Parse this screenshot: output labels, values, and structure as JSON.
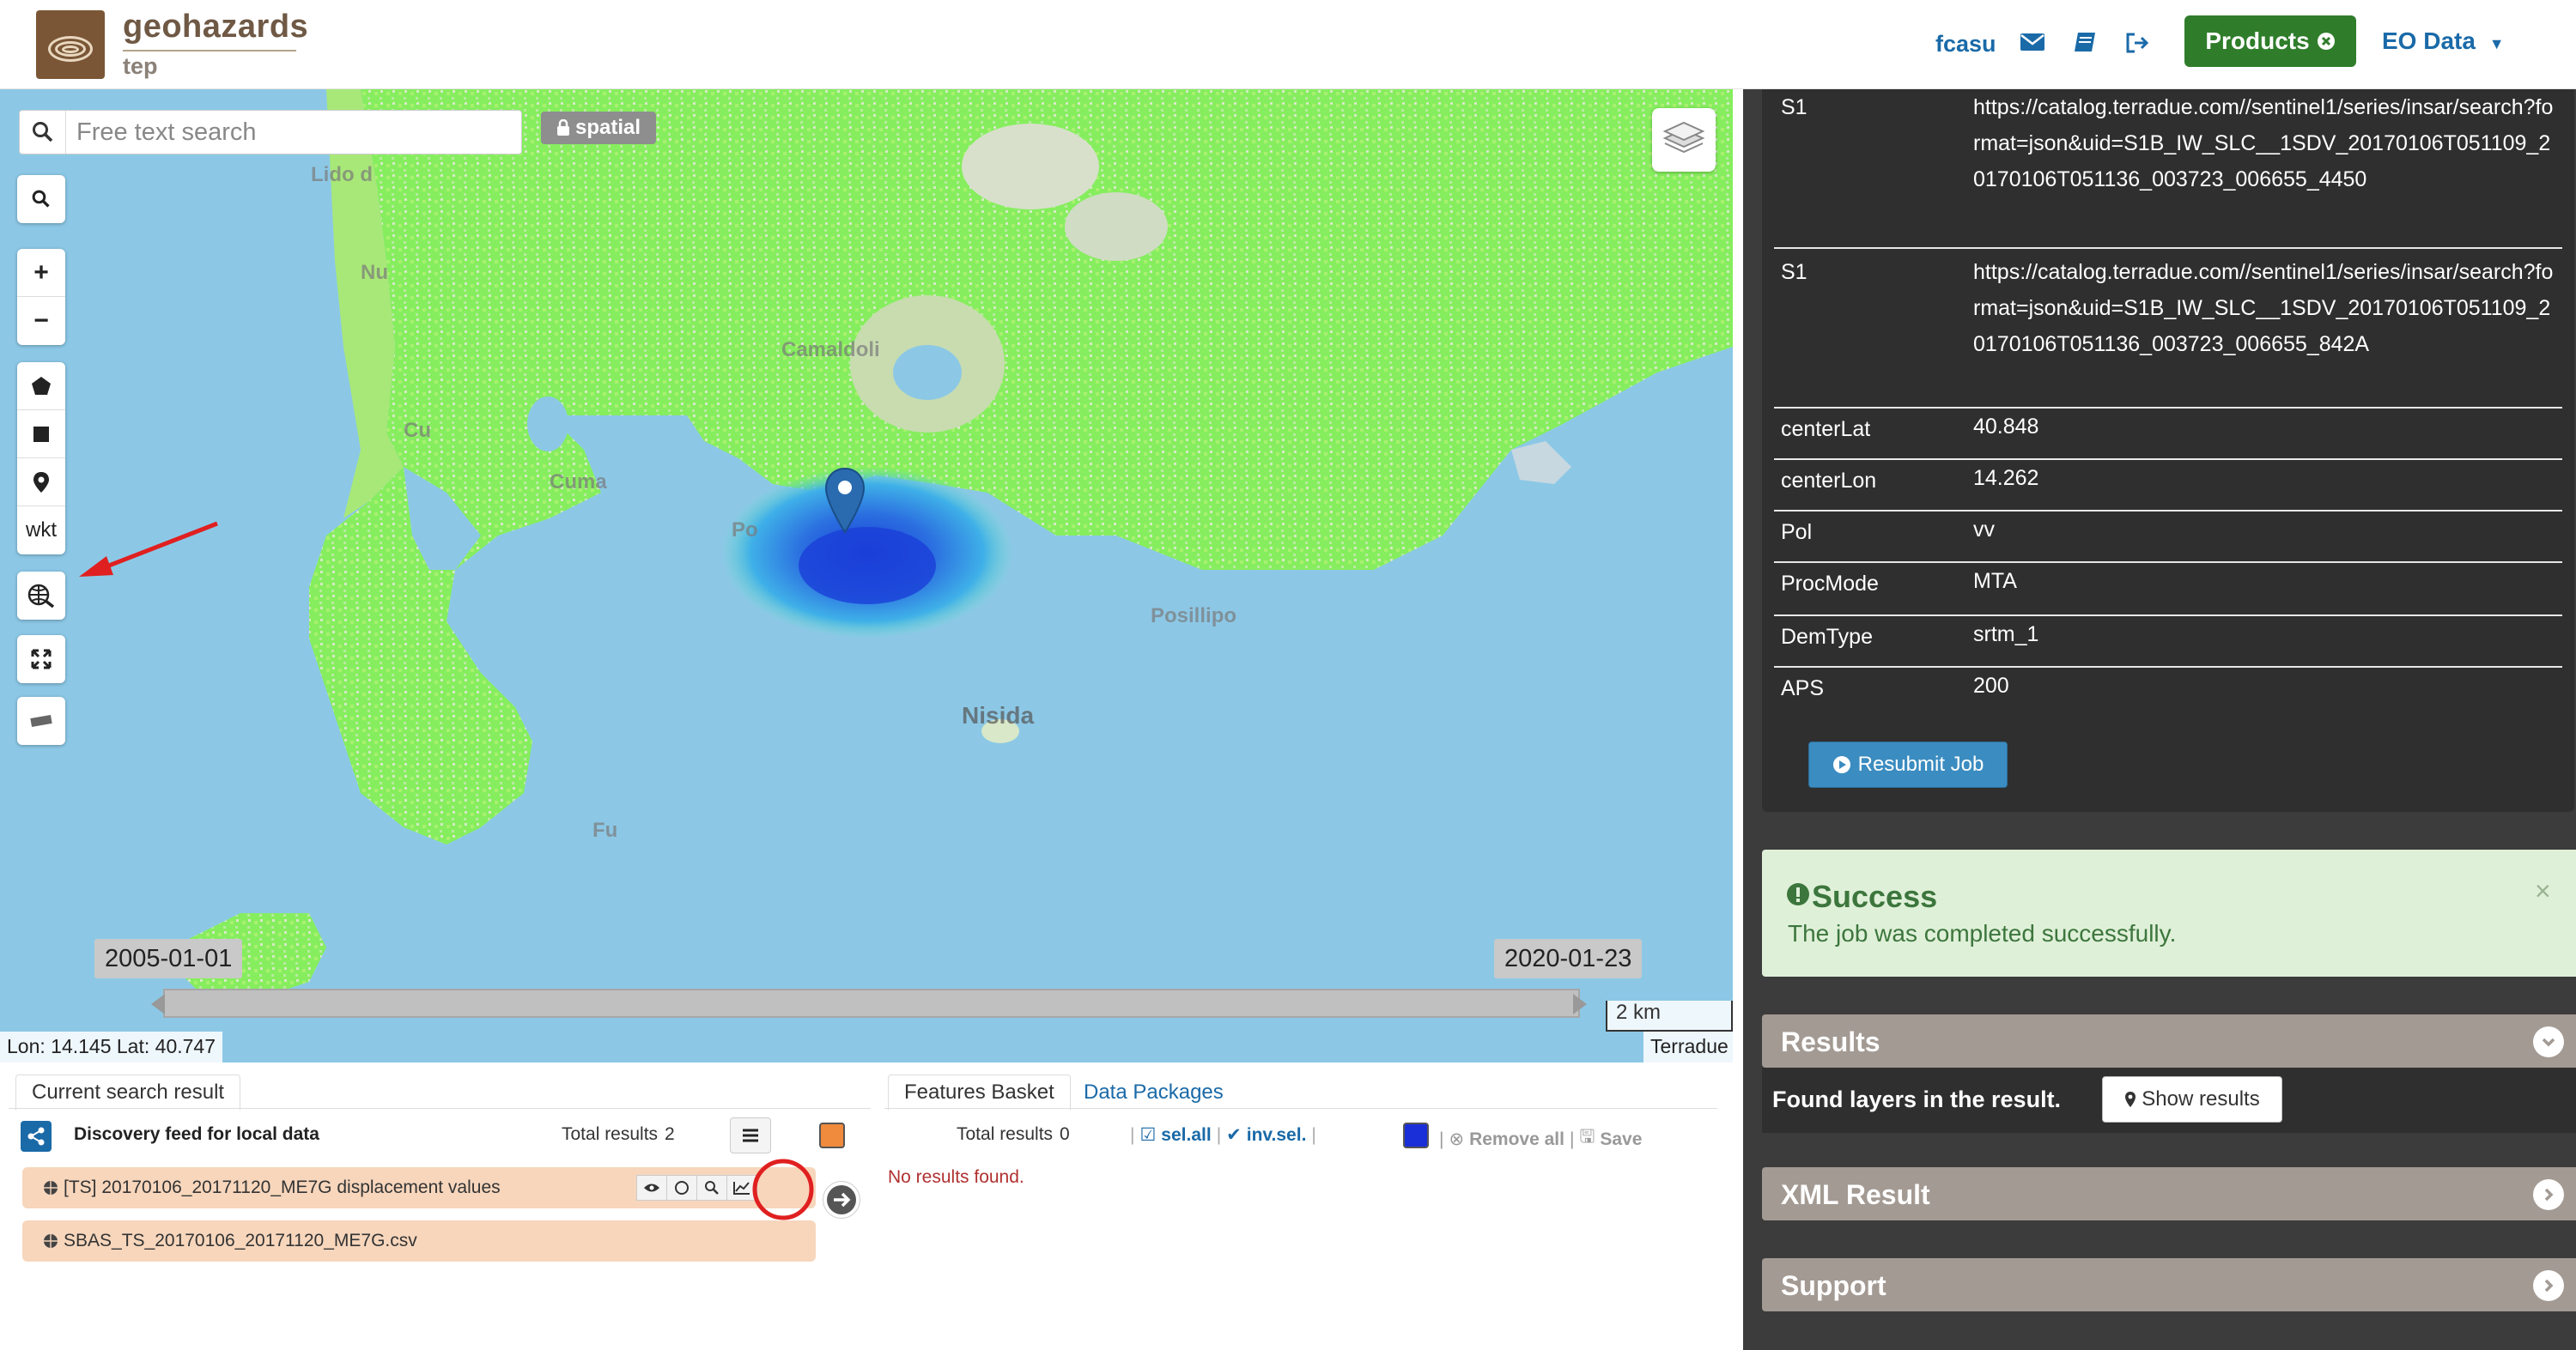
{
  "header": {
    "logo_title": "geohazards",
    "logo_subtitle": "tep",
    "username": "fcasu",
    "products_label": "Products",
    "eodata_label": "EO Data",
    "icons": [
      "envelope-icon",
      "book-icon",
      "sign-out-icon"
    ]
  },
  "map": {
    "search_placeholder": "Free text search",
    "spatial_label": "spatial",
    "tools": {
      "zoom_in": "+",
      "zoom_out": "−",
      "wkt": "wkt"
    },
    "place_names": [
      "Lido d",
      "Nu",
      "Cu",
      "Cuma",
      "Po",
      "Fu",
      "Nisida",
      "Posillipo",
      "Camaldoli"
    ],
    "timeline": {
      "start_date": "2005-01-01",
      "end_date": "2020-01-23"
    },
    "scale_label": "2 km",
    "coords_text": "Lon: 14.145 Lat: 40.747",
    "attribution": "Terradue",
    "marker_color": "#2a6bb0",
    "displacement_colors": {
      "stable": "#7ef05a",
      "moderate": "#3aa0e0",
      "high": "#1a3fd8"
    }
  },
  "bottom_left": {
    "tab_label": "Current search result",
    "feed_label": "Discovery feed for local data",
    "total_results_label": "Total results",
    "total_results_value": "2",
    "swatch_color": "#f08a3c",
    "results": [
      {
        "name": "[TS] 20170106_20171120_ME7G displacement values"
      },
      {
        "name": "SBAS_TS_20170106_20171120_ME7G.csv"
      }
    ]
  },
  "bottom_right": {
    "tabs": [
      "Features Basket",
      "Data Packages"
    ],
    "total_results_label": "Total results",
    "total_results_value": "0",
    "sel_all": "sel.all",
    "inv_sel": "inv.sel.",
    "remove_all": "Remove all",
    "save": "Save",
    "no_results": "No results found.",
    "swatch_color": "#1a2fd8"
  },
  "properties": [
    {
      "key": "S1",
      "value": "https://catalog.terradue.com//sentinel1/series/insar/search?format=json&uid=S1B_IW_SLC__1SDV_20170106T051109_20170106T051136_003723_006655_4450"
    },
    {
      "key": "S1",
      "value": "https://catalog.terradue.com//sentinel1/series/insar/search?format=json&uid=S1B_IW_SLC__1SDV_20170106T051109_20170106T051136_003723_006655_842A"
    },
    {
      "key": "centerLat",
      "value": "40.848"
    },
    {
      "key": "centerLon",
      "value": "14.262"
    },
    {
      "key": "Pol",
      "value": "vv"
    },
    {
      "key": "ProcMode",
      "value": "MTA"
    },
    {
      "key": "DemType",
      "value": "srtm_1"
    },
    {
      "key": "APS",
      "value": "200"
    }
  ],
  "resubmit_label": "Resubmit Job",
  "alert": {
    "title": "Success",
    "message": "The job was completed successfully.",
    "close": "×"
  },
  "accordions": {
    "results_title": "Results",
    "found_text": "Found layers in the result.",
    "show_results": "Show results",
    "xml_title": "XML Result",
    "support_title": "Support"
  }
}
